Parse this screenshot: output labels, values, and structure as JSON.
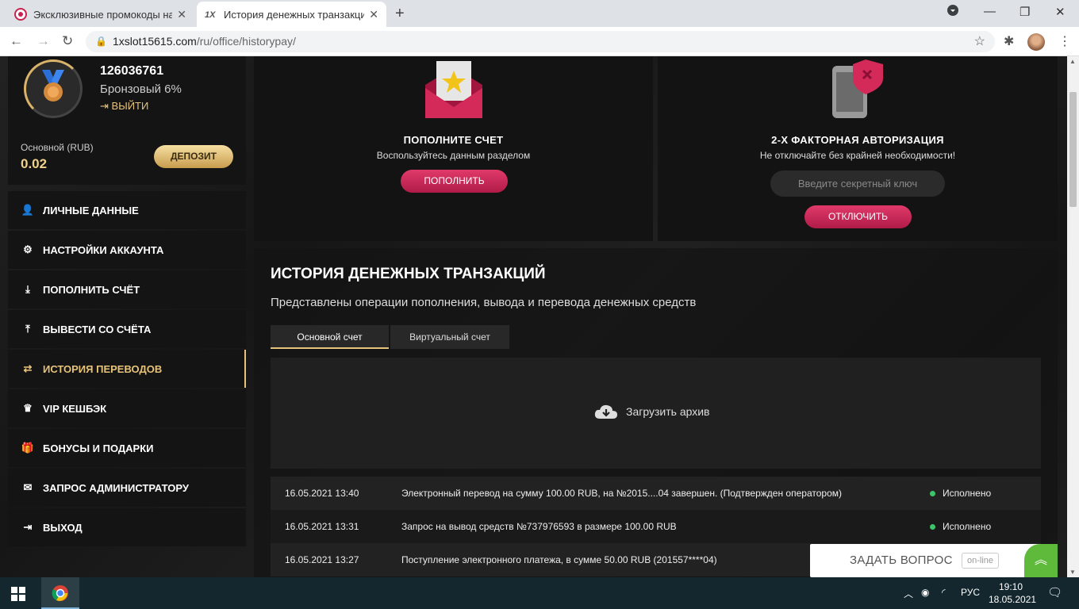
{
  "browser": {
    "tabs": [
      {
        "title": "Эксклюзивные промокоды на ф",
        "active": false
      },
      {
        "title": "История денежных транзакций",
        "active": true
      }
    ],
    "url_host": "1xslot15615.com",
    "url_path": "/ru/office/historypay/"
  },
  "profile": {
    "user_id": "126036761",
    "rank": "Бронзовый 6%",
    "logout_label": "ВЫЙТИ",
    "balance_label": "Основной (RUB)",
    "balance_value": "0.02",
    "deposit_label": "ДЕПОЗИТ"
  },
  "menu": [
    {
      "label": "ЛИЧНЫЕ ДАННЫЕ",
      "icon": "user-add-icon"
    },
    {
      "label": "НАСТРОЙКИ АККАУНТА",
      "icon": "gears-icon"
    },
    {
      "label": "ПОПОЛНИТЬ СЧЁТ",
      "icon": "download-icon"
    },
    {
      "label": "ВЫВЕСТИ СО СЧЁТА",
      "icon": "upload-icon"
    },
    {
      "label": "ИСТОРИЯ ПЕРЕВОДОВ",
      "icon": "transfer-icon",
      "active": true
    },
    {
      "label": "VIP КЕШБЭК",
      "icon": "crown-icon"
    },
    {
      "label": "БОНУСЫ И ПОДАРКИ",
      "icon": "gift-icon"
    },
    {
      "label": "ЗАПРОС АДМИНИСТРАТОРУ",
      "icon": "envelope-icon"
    },
    {
      "label": "ВЫХОД",
      "icon": "exit-icon"
    }
  ],
  "cards": {
    "deposit": {
      "title": "ПОПОЛНИТЕ СЧЕТ",
      "subtitle": "Воспользуйтесь данным разделом",
      "button": "ПОПОЛНИТЬ"
    },
    "twofa": {
      "title": "2-Х ФАКТОРНАЯ АВТОРИЗАЦИЯ",
      "subtitle": "Не отключайте без крайней необходимости!",
      "input_placeholder": "Введите секретный ключ",
      "button": "ОТКЛЮЧИТЬ"
    }
  },
  "history": {
    "title": "ИСТОРИЯ ДЕНЕЖНЫХ ТРАНЗАКЦИЙ",
    "subtitle": "Представлены операции пополнения, вывода и перевода денежных средств",
    "tabs": [
      "Основной счет",
      "Виртуальный счет"
    ],
    "archive_label": "Загрузить архив",
    "rows": [
      {
        "date": "16.05.2021 13:40",
        "description": "Электронный перевод на сумму 100.00 RUB, на №2015....04 завершен. (Подтвержден оператором)",
        "status": "Исполнено"
      },
      {
        "date": "16.05.2021 13:31",
        "description": "Запрос на вывод средств №737976593 в размере 100.00 RUB",
        "status": "Исполнено"
      },
      {
        "date": "16.05.2021 13:27",
        "description": "Поступление электронного платежа, в сумме 50.00 RUB (201557****04)",
        "status": ""
      }
    ]
  },
  "chat": {
    "label": "ЗАДАТЬ ВОПРОС",
    "online": "on-line"
  },
  "taskbar": {
    "lang": "РУС",
    "time": "19:10",
    "date": "18.05.2021"
  },
  "colors": {
    "accent_gold": "#e7c37a",
    "button_pink": "#c8234f",
    "status_green": "#3ec46b"
  }
}
